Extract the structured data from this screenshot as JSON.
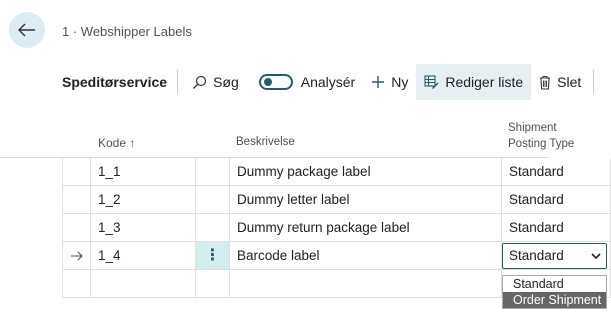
{
  "breadcrumb": "1 · Webshipper Labels",
  "toolbar": {
    "title": "Speditørservice",
    "search_label": "Søg",
    "analyze_label": "Analysér",
    "new_label": "Ny",
    "edit_list_label": "Rediger liste",
    "delete_label": "Slet"
  },
  "columns": {
    "code": "Kode",
    "code_sort": "↑",
    "description": "Beskrivelse",
    "shipment_line1": "Shipment",
    "shipment_line2": "Posting Type"
  },
  "rows": [
    {
      "code": "1_1",
      "description": "Dummy package label",
      "type": "Standard"
    },
    {
      "code": "1_2",
      "description": "Dummy letter label",
      "type": "Standard"
    },
    {
      "code": "1_3",
      "description": "Dummy return package label",
      "type": "Standard"
    },
    {
      "code": "1_4",
      "description": "Barcode label",
      "type": "Standard"
    }
  ],
  "row_menu": "⋮",
  "dropdown_options": [
    "Standard",
    "Order Shipment"
  ],
  "colors": {
    "accent": "#275c6b",
    "selected_cell": "#d4eef0",
    "back_button_bg": "#dcecf2"
  }
}
